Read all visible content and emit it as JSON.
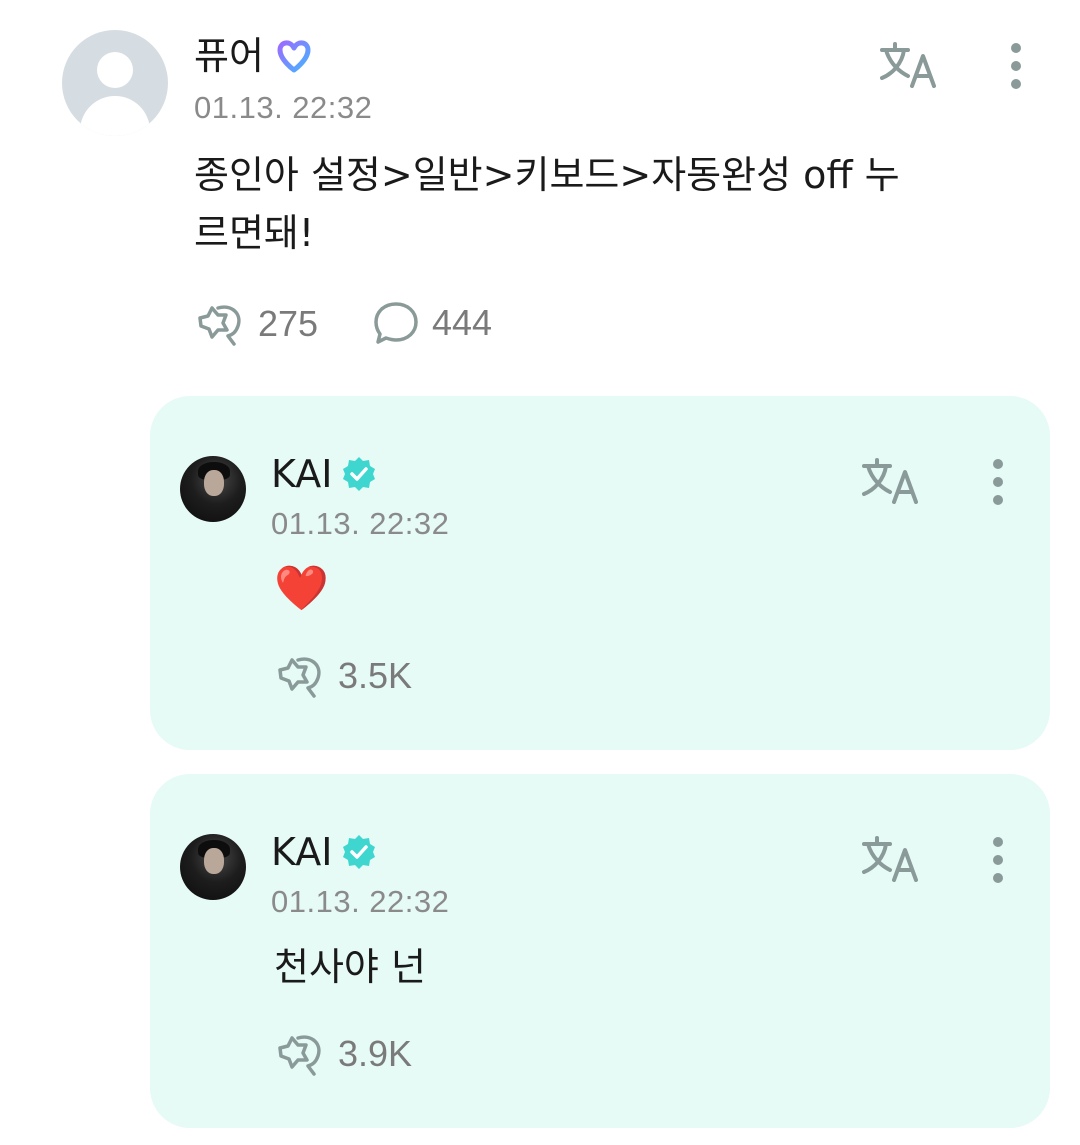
{
  "post": {
    "author": "퓨어",
    "timestamp": "01.13. 22:32",
    "text": "종인아 설정>일반>키보드>자동완성 off 누\n르면돼!",
    "likes": "275",
    "comments": "444",
    "badge_icon": "weverse-membership-icon"
  },
  "replies": [
    {
      "author": "KAI",
      "timestamp": "01.13. 22:32",
      "text": "❤️",
      "likes": "3.5K",
      "badge_icon": "verified-check-icon"
    },
    {
      "author": "KAI",
      "timestamp": "01.13. 22:32",
      "text": "천사야 넌",
      "likes": "3.9K",
      "badge_icon": "verified-check-icon"
    }
  ],
  "colors": {
    "card_bg": "#e6faf6",
    "verified": "#3fd6d0",
    "icon_gray": "#8a9a98",
    "heart": "#e3242b"
  }
}
